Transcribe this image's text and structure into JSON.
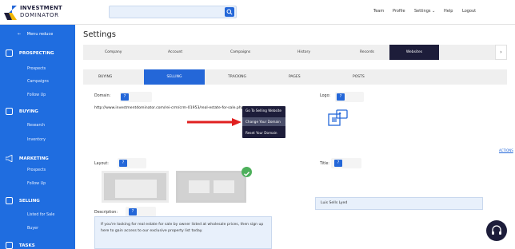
{
  "brand": {
    "line1": "INVESTMENT",
    "line2": "DOMINATOR"
  },
  "search": {
    "placeholder": ""
  },
  "topnav": {
    "team": "Team",
    "profile": "Profile",
    "settings": "Settings",
    "help": "Help",
    "logout": "Logout"
  },
  "sidebar": {
    "toggle": "Menu reduce",
    "sections": {
      "prospecting": {
        "label": "PROSPECTING",
        "items": [
          "Prospects",
          "Campaigns",
          "Follow Up"
        ]
      },
      "buying": {
        "label": "BUYING",
        "items": [
          "Research",
          "Inventory"
        ]
      },
      "marketing": {
        "label": "MARKETING",
        "items": [
          "Prospects",
          "Follow Up"
        ]
      },
      "selling": {
        "label": "SELLING",
        "items": [
          "Listed for Sale",
          "Buyer"
        ]
      },
      "tasks": {
        "label": "TASKS"
      }
    }
  },
  "page": {
    "title": "Settings"
  },
  "tabs_primary": [
    "Company",
    "Account",
    "Campaigns",
    "History",
    "Records",
    "Websites"
  ],
  "tabs_primary_active": "Websites",
  "tabs_secondary": [
    "BUYING",
    "SELLING",
    "TRACKING",
    "PAGES",
    "POSTS"
  ],
  "tabs_secondary_active": "SELLING",
  "website": {
    "domain_label": "Domain:",
    "domain_url": "http://www.investmentdominator.com/rei-crm/crm-01953/real-estate-for-sale.php",
    "dropdown": [
      "Go To Selling Website",
      "Change Your Domain",
      "Reset Your Domain"
    ],
    "logo_label": "Logo:",
    "actions_link": "ACTIONS",
    "layout_label": "Layout:",
    "title_label": "Title:",
    "title_value": "Luis Sells Lyed",
    "description_label": "Description:",
    "description_value": "If you're looking for real estate for sale by owner listed at wholesale prices, then sign up here to gain access to our exclusive property list today."
  },
  "badge_text": "?",
  "colors": {
    "primary": "#2467d8",
    "sidebar": "#1f6de0",
    "dark": "#1d1d3a",
    "success": "#4db05b",
    "arrow": "#e02020"
  }
}
